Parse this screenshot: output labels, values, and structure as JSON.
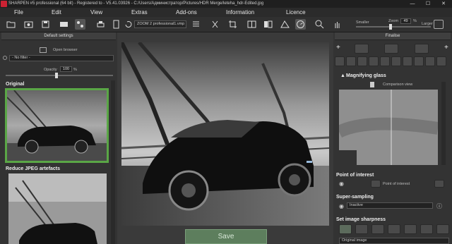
{
  "window": {
    "title": "SHARPEN #5 professional (64 bit) - Registered to - V5.41.03926 - C:/Users/Администратор/Pictures/HDR Merge/leteha_hdr-Edited.jpg",
    "minimize": "—",
    "maximize": "☐",
    "close": "✕"
  },
  "menu": [
    "File",
    "Edit",
    "View",
    "Extras",
    "Add-ons",
    "Information",
    "Licence"
  ],
  "toolbar": {
    "zoom_preset": "ZOOM 2 professional1.vmp",
    "smaller_label": "Smaller",
    "zoom_label": "Zoom",
    "zoom_value": "49",
    "zoom_unit": "%",
    "larger_label": "Larger"
  },
  "left": {
    "header": "Default settings",
    "open_browser": "Open browser",
    "filter": "- No filter -",
    "opacity_label": "Opacity",
    "opacity_value": "100",
    "opacity_unit": "%",
    "thumb1_label": "Original",
    "thumb2_label": "Reduce JPEG artefacts"
  },
  "right": {
    "header": "Finalise",
    "magnifying_glass": "Magnifying glass",
    "comparison_view": "Comparison view",
    "point_of_interest": "Point of interest",
    "point_of_interest_btn": "Point of interest",
    "super_sampling": "Super-sampling",
    "super_sampling_value": "Inactive",
    "set_image_sharpness": "Set image sharpness",
    "sharpness_value": "Original image"
  },
  "save_label": "Save",
  "colors": {
    "accent_green": "#5aa646",
    "save_bg": "#5d7e5d"
  }
}
